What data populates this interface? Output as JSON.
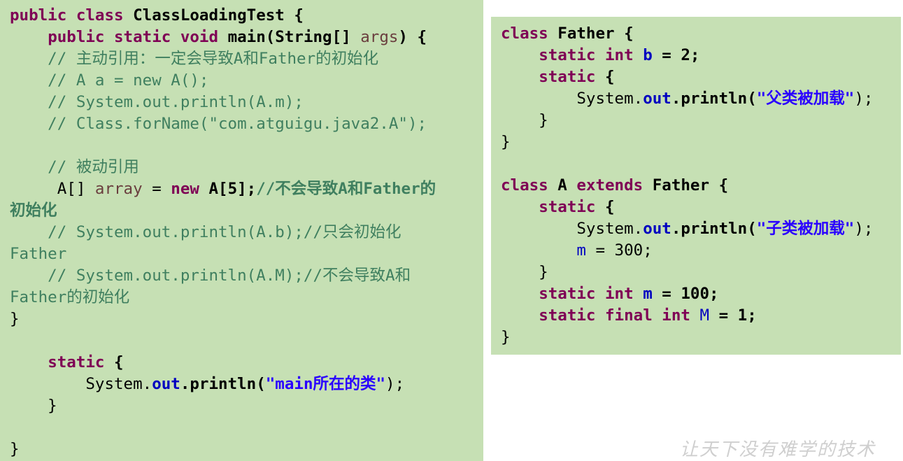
{
  "left_code": [
    [
      [
        "kw",
        "public class "
      ],
      [
        "b",
        "ClassLoadingTest {"
      ]
    ],
    [
      [
        "plain",
        "    "
      ],
      [
        "kw",
        "public static void "
      ],
      [
        "b",
        "main(String[] "
      ],
      [
        "var",
        "args"
      ],
      [
        "b",
        ") {"
      ]
    ],
    [
      [
        "cm",
        "    // 主动引用：一定会导致A和Father的初始化"
      ]
    ],
    [
      [
        "cm",
        "    // A a = new A();"
      ]
    ],
    [
      [
        "cm",
        "    // System.out.println(A.m);"
      ]
    ],
    [
      [
        "cm",
        "    // Class.forName(\"com.atguigu.java2.A\");"
      ]
    ],
    [],
    [
      [
        "cm",
        "    // 被动引用"
      ]
    ],
    [
      [
        "plain",
        "     A[] "
      ],
      [
        "var",
        "array"
      ],
      [
        "plain",
        " = "
      ],
      [
        "kw",
        "new "
      ],
      [
        "b",
        "A[5];"
      ],
      [
        "cmb",
        "//不会导致A和Father的"
      ]
    ],
    [
      [
        "cmb",
        "初始化"
      ]
    ],
    [
      [
        "cm",
        "    // System.out.println(A.b);//只会初始化"
      ]
    ],
    [
      [
        "cm",
        "Father"
      ]
    ],
    [
      [
        "cm",
        "    // System.out.println(A.M);//不会导致A和"
      ]
    ],
    [
      [
        "cm",
        "Father的初始化"
      ]
    ],
    [
      [
        "plain",
        "}"
      ]
    ],
    [],
    [
      [
        "plain",
        "    "
      ],
      [
        "kw",
        "static"
      ],
      [
        "b",
        " {"
      ]
    ],
    [
      [
        "plain",
        "        System."
      ],
      [
        "fldb",
        "out"
      ],
      [
        "b",
        ".println("
      ],
      [
        "str",
        "\"main所在的类\""
      ],
      [
        "plain",
        ");"
      ]
    ],
    [
      [
        "plain",
        "    }"
      ]
    ],
    [],
    [
      [
        "plain",
        "}"
      ]
    ]
  ],
  "right_code": [
    [
      [
        "kw",
        "class "
      ],
      [
        "b",
        "Father {"
      ]
    ],
    [
      [
        "plain",
        "    "
      ],
      [
        "kw",
        "static int "
      ],
      [
        "fldb",
        "b"
      ],
      [
        "b",
        " = 2;"
      ]
    ],
    [
      [
        "plain",
        "    "
      ],
      [
        "kw",
        "static"
      ],
      [
        "b",
        " {"
      ]
    ],
    [
      [
        "plain",
        "        System."
      ],
      [
        "fldb",
        "out"
      ],
      [
        "b",
        ".println("
      ],
      [
        "str",
        "\"父类被加载\""
      ],
      [
        "plain",
        ");"
      ]
    ],
    [
      [
        "plain",
        "    }"
      ]
    ],
    [
      [
        "plain",
        "}"
      ]
    ],
    [],
    [
      [
        "kw",
        "class "
      ],
      [
        "b",
        "A "
      ],
      [
        "kw",
        "extends "
      ],
      [
        "b",
        "Father {"
      ]
    ],
    [
      [
        "plain",
        "    "
      ],
      [
        "kw",
        "static"
      ],
      [
        "b",
        " {"
      ]
    ],
    [
      [
        "plain",
        "        System."
      ],
      [
        "fldb",
        "out"
      ],
      [
        "b",
        ".println("
      ],
      [
        "str",
        "\"子类被加载\""
      ],
      [
        "plain",
        ");"
      ]
    ],
    [
      [
        "plain",
        "        "
      ],
      [
        "fld",
        "m"
      ],
      [
        "plain",
        " = 300;"
      ]
    ],
    [
      [
        "plain",
        "    }"
      ]
    ],
    [
      [
        "plain",
        "    "
      ],
      [
        "kw",
        "static int "
      ],
      [
        "fldb",
        "m"
      ],
      [
        "b",
        " = 100;"
      ]
    ],
    [
      [
        "plain",
        "    "
      ],
      [
        "kw",
        "static final int "
      ],
      [
        "fld",
        "M"
      ],
      [
        "b",
        " = 1;"
      ]
    ],
    [
      [
        "plain",
        "}"
      ]
    ]
  ],
  "watermark": "让天下没有难学的技术",
  "colors": {
    "panel_bg": "#c6e0b4",
    "keyword": "#7f0055",
    "comment": "#3f7f5f",
    "string": "#2a00ff",
    "field": "#0000c0",
    "variable": "#6a3e3e"
  }
}
